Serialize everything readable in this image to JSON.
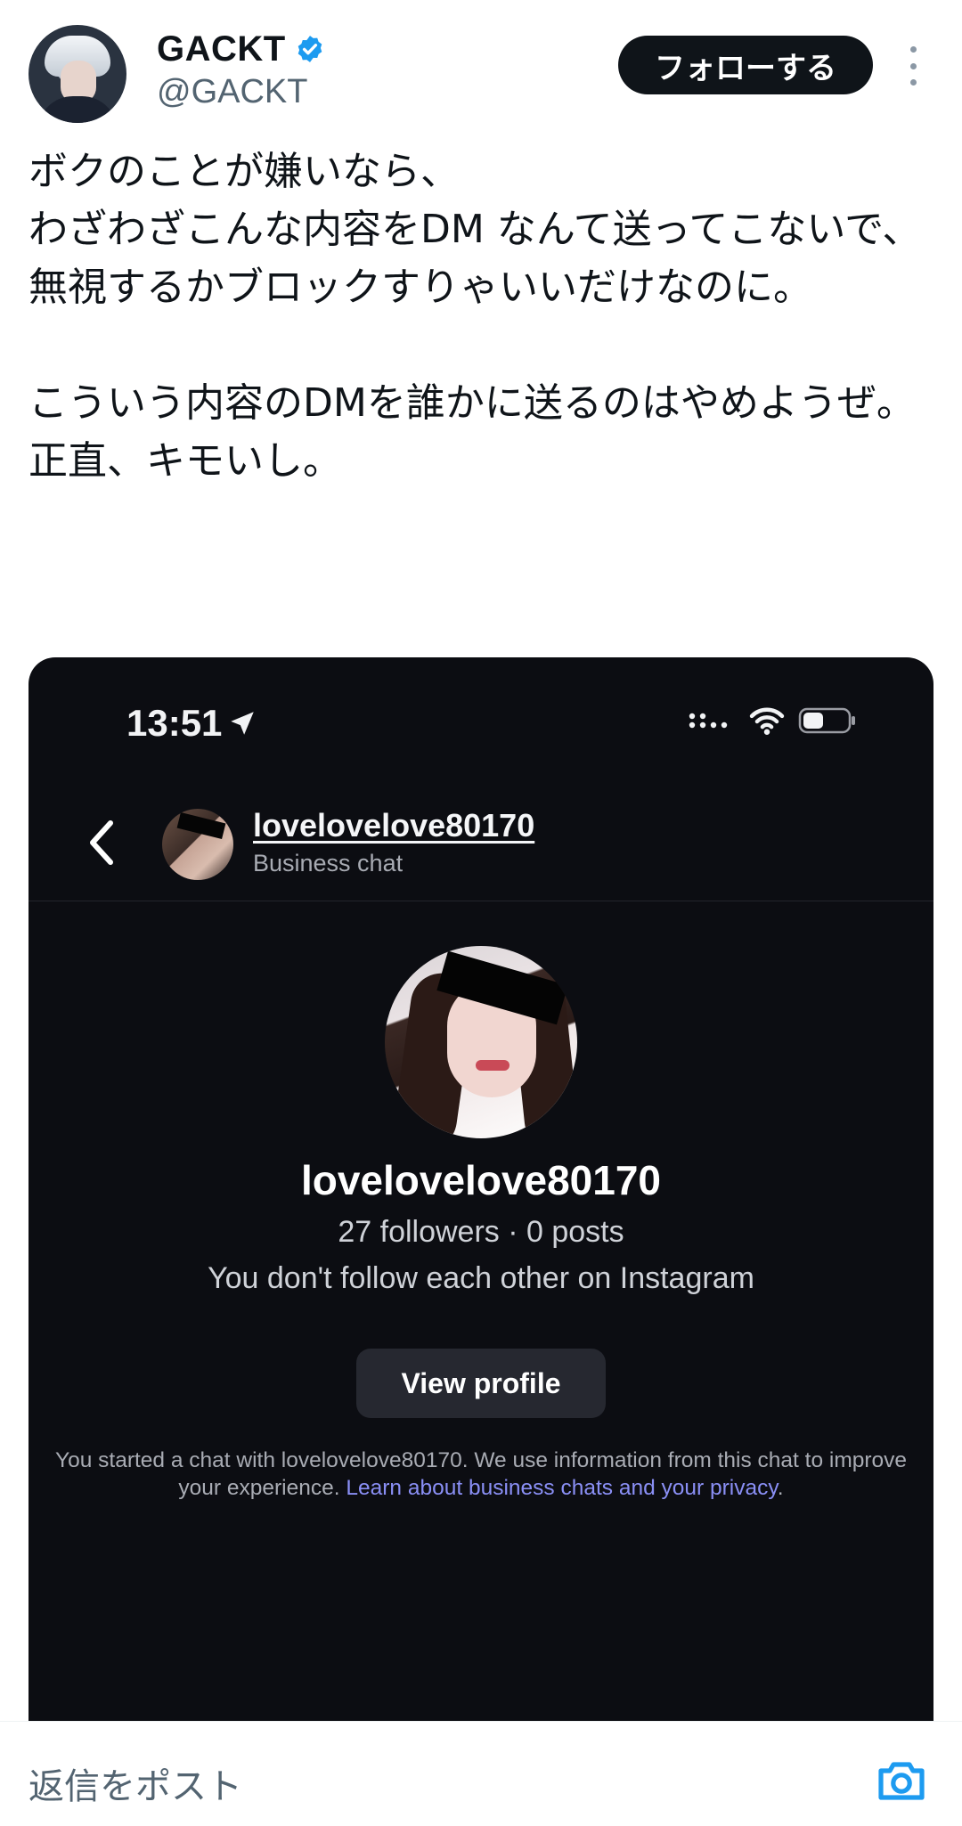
{
  "author": {
    "display_name": "GACKT",
    "handle": "@GACKT",
    "verified": true
  },
  "follow_button": {
    "label": "フォローする"
  },
  "tweet": {
    "text": "ボクのことが嫌いなら、\nわざわざこんな内容をDM なんて送ってこないで、\n無視するかブロックすりゃいいだけなのに。\n\nこういう内容のDMを誰かに送るのはやめようぜ。\n正直、キモいし。"
  },
  "media": {
    "status_bar": {
      "time": "13:51"
    },
    "chat_header": {
      "username": "lovelovelove80170",
      "subtitle": "Business chat"
    },
    "profile": {
      "username": "lovelovelove80170",
      "stats": "27 followers · 0 posts",
      "follow_note": "You don't follow each other on Instagram",
      "view_profile_label": "View profile"
    },
    "info": {
      "text": "You started a chat with lovelovelove80170. We use information from this chat to improve your experience. ",
      "link_text": "Learn about business chats and your privacy",
      "trailing": "."
    }
  },
  "reply_bar": {
    "placeholder": "返信をポスト",
    "icon": "camera-icon"
  },
  "colors": {
    "follow_button_bg": "#0f1419",
    "verified_blue": "#1d9bf0",
    "media_bg": "#0c0d12",
    "link_purple": "#8a8ff5"
  }
}
